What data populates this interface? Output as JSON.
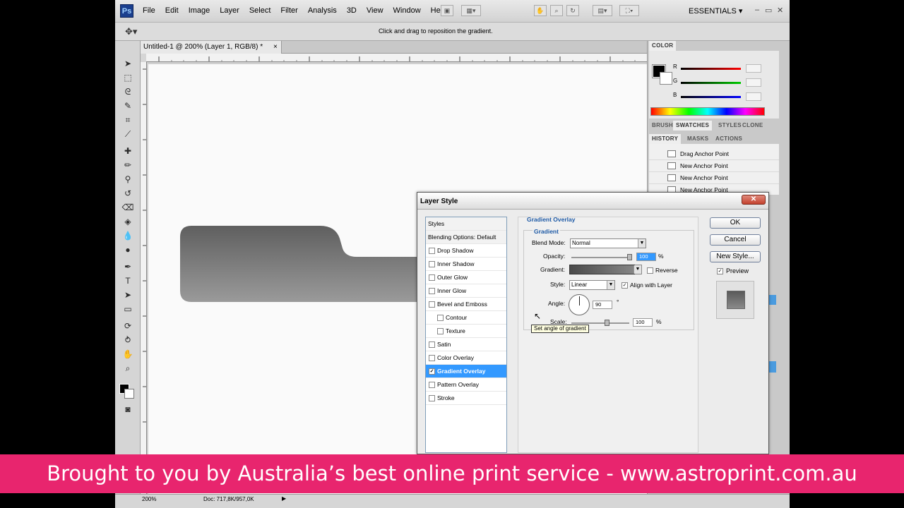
{
  "app": {
    "logo": "Ps",
    "menu": [
      "File",
      "Edit",
      "Image",
      "Layer",
      "Select",
      "Filter",
      "Analysis",
      "3D",
      "View",
      "Window",
      "Help"
    ],
    "workspace": "ESSENTIALS",
    "window_controls": [
      "–",
      "▭",
      "✕"
    ]
  },
  "options_bar": {
    "hint": "Click and drag to reposition the gradient."
  },
  "document": {
    "tab_title": "Untitled-1 @ 200% (Layer 1, RGB/8) *",
    "tab_close": "×",
    "shape_gradient": {
      "top": "#5f5f5f",
      "bottom": "#9a9a9a"
    }
  },
  "status_bar": {
    "zoom": "200%",
    "doc_info": "Doc: 717,8K/957,0K"
  },
  "panels": {
    "color": {
      "tab": "COLOR",
      "channels": [
        {
          "label": "R",
          "color": "#cc0000"
        },
        {
          "label": "G",
          "color": "#00aa00"
        },
        {
          "label": "B",
          "color": "#0000cc"
        }
      ]
    },
    "tabs_row1": [
      "BRUSH",
      "SWATCHES",
      "STYLES",
      "CLONE"
    ],
    "tabs_row2": [
      "HISTORY",
      "MASKS",
      "ACTIONS"
    ],
    "history": [
      "Drag Anchor Point",
      "New Anchor Point",
      "New Anchor Point",
      "New Anchor Point"
    ]
  },
  "dialog": {
    "title": "Layer Style",
    "close": "✕",
    "styles_header": "Styles",
    "blending": "Blending Options: Default",
    "items": [
      {
        "label": "Drop Shadow",
        "checked": false,
        "indent": false
      },
      {
        "label": "Inner Shadow",
        "checked": false,
        "indent": false
      },
      {
        "label": "Outer Glow",
        "checked": false,
        "indent": false
      },
      {
        "label": "Inner Glow",
        "checked": false,
        "indent": false
      },
      {
        "label": "Bevel and Emboss",
        "checked": false,
        "indent": false
      },
      {
        "label": "Contour",
        "checked": false,
        "indent": true
      },
      {
        "label": "Texture",
        "checked": false,
        "indent": true
      },
      {
        "label": "Satin",
        "checked": false,
        "indent": false
      },
      {
        "label": "Color Overlay",
        "checked": false,
        "indent": false
      },
      {
        "label": "Gradient Overlay",
        "checked": true,
        "indent": false,
        "selected": true
      },
      {
        "label": "Pattern Overlay",
        "checked": false,
        "indent": false
      },
      {
        "label": "Stroke",
        "checked": false,
        "indent": false
      }
    ],
    "section_title": "Gradient Overlay",
    "subsection_title": "Gradient",
    "blend_mode_label": "Blend Mode:",
    "blend_mode_value": "Normal",
    "opacity_label": "Opacity:",
    "opacity_value": "100",
    "percent": "%",
    "gradient_label": "Gradient:",
    "reverse_label": "Reverse",
    "style_label": "Style:",
    "style_value": "Linear",
    "align_label": "Align with Layer",
    "angle_label": "Angle:",
    "angle_value": "90",
    "degree": "°",
    "scale_label": "Scale:",
    "scale_value": "100",
    "tooltip": "Set angle of gradient",
    "ok": "OK",
    "cancel": "Cancel",
    "new_style": "New Style...",
    "preview_label": "Preview",
    "checkmark": "✓"
  },
  "banner": {
    "text": "Brought to you by Australia’s best online print service - www.astroprint.com.au"
  }
}
